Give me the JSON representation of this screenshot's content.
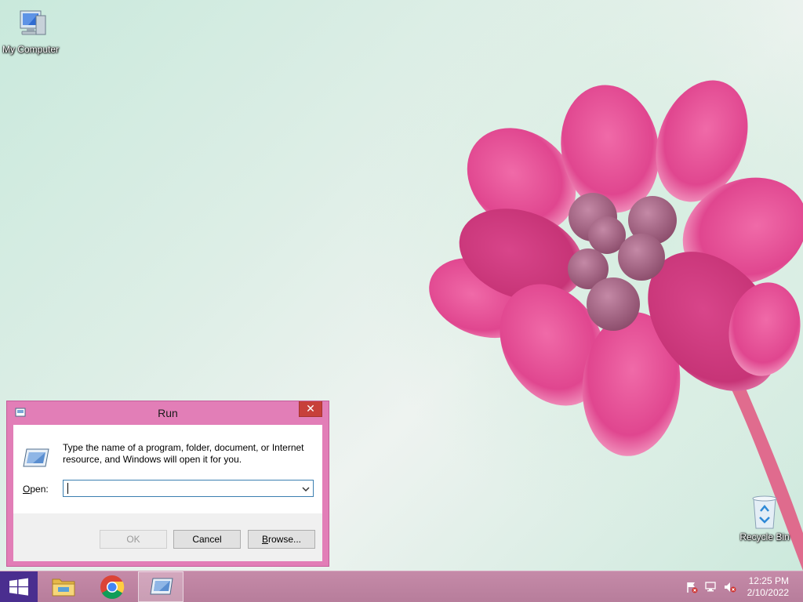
{
  "desktop": {
    "icons": [
      {
        "label": "My Computer",
        "icon": "computer-icon"
      },
      {
        "label": "Recycle Bin",
        "icon": "recycle-bin-icon"
      }
    ]
  },
  "run_dialog": {
    "title": "Run",
    "close_label": "✕",
    "description": "Type the name of a program, folder, document, or Internet resource, and Windows will open it for you.",
    "open_label_accel": "O",
    "open_label_rest": "pen:",
    "open_value": "",
    "ok_label": "OK",
    "cancel_label": "Cancel",
    "browse_label_accel": "B",
    "browse_label_rest": "rowse..."
  },
  "taskbar": {
    "items": [
      {
        "name": "file-explorer",
        "icon": "folder-icon"
      },
      {
        "name": "chrome",
        "icon": "chrome-icon"
      },
      {
        "name": "run",
        "icon": "run-icon",
        "active": true
      }
    ],
    "tray": {
      "icons": [
        "action-center-flag-icon",
        "network-icon",
        "volume-muted-icon"
      ],
      "time": "12:25 PM",
      "date": "2/10/2022"
    }
  },
  "colors": {
    "window_accent": "#e27eb7",
    "taskbar": "#bd82a1",
    "close_button": "#c7403a"
  }
}
